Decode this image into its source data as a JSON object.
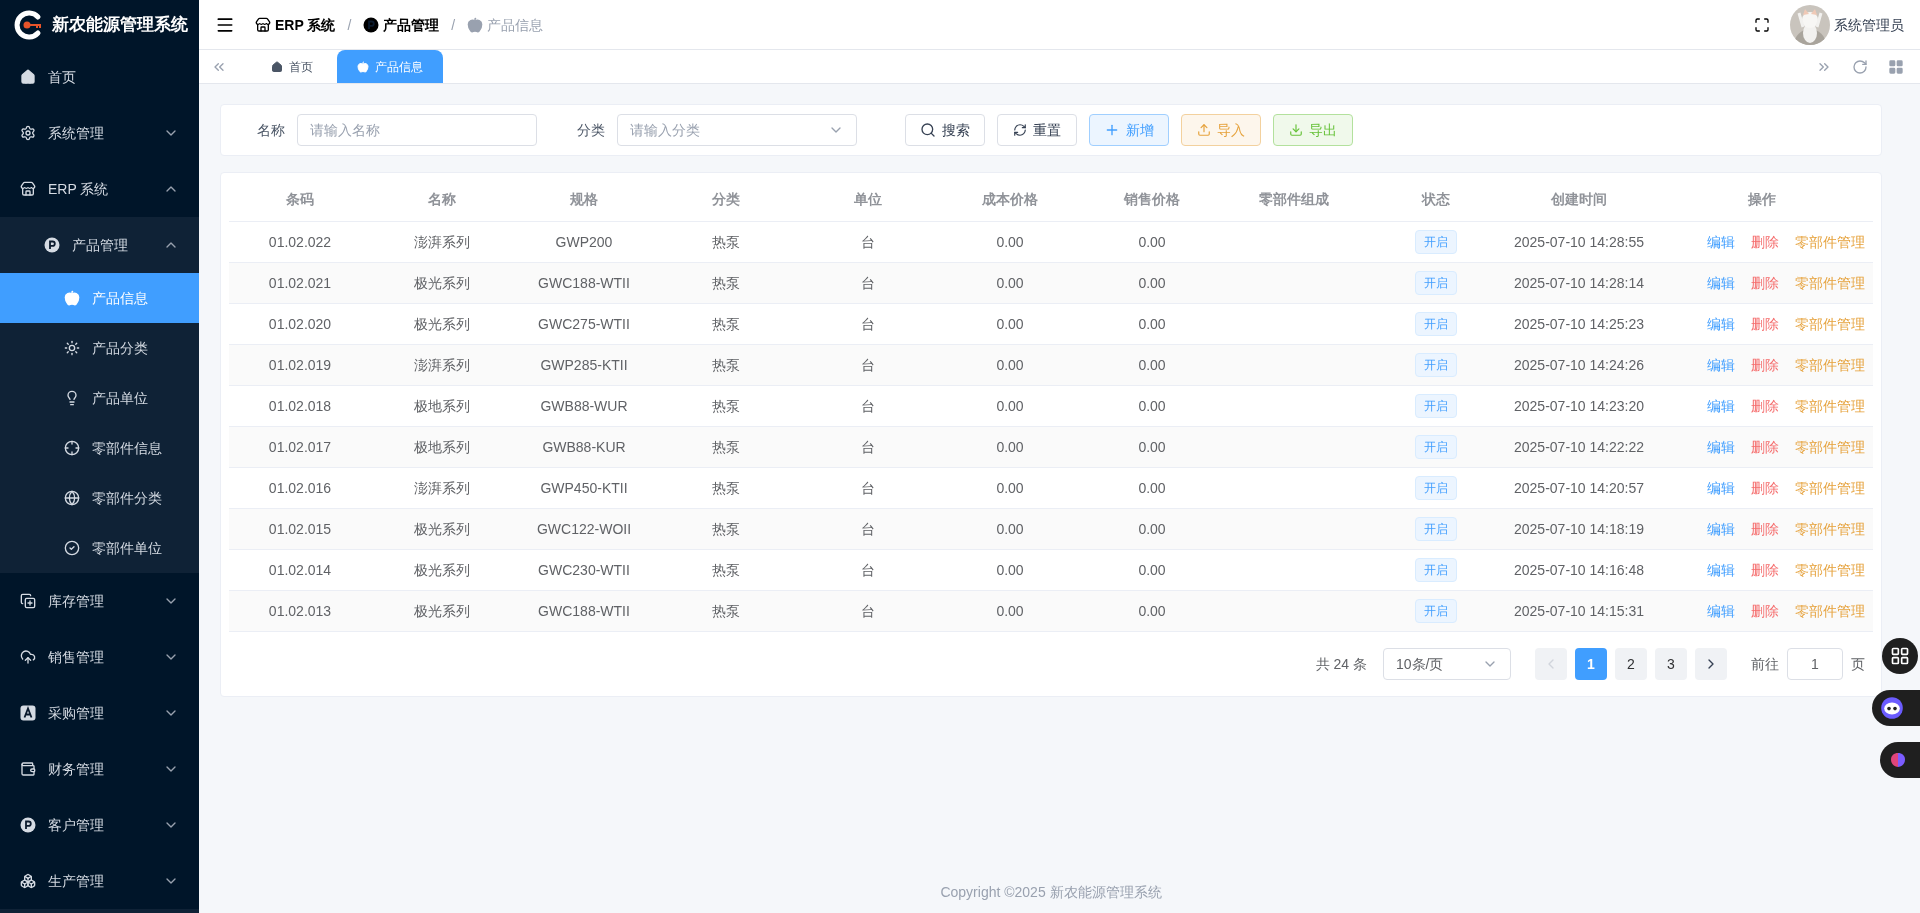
{
  "sidebar": {
    "title": "新农能源管理系统",
    "items": [
      {
        "label": "首页",
        "selected": false
      },
      {
        "label": "系统管理",
        "selected": false,
        "expanded": false
      },
      {
        "label": "ERP 系统",
        "selected": false,
        "expanded": true,
        "children": [
          {
            "label": "产品管理",
            "selected": false,
            "expanded": true,
            "children": [
              {
                "label": "产品信息",
                "selected": true
              },
              {
                "label": "产品分类",
                "selected": false
              },
              {
                "label": "产品单位",
                "selected": false
              },
              {
                "label": "零部件信息",
                "selected": false
              },
              {
                "label": "零部件分类",
                "selected": false
              },
              {
                "label": "零部件单位",
                "selected": false
              }
            ]
          }
        ]
      },
      {
        "label": "库存管理",
        "selected": false,
        "expanded": false
      },
      {
        "label": "销售管理",
        "selected": false,
        "expanded": false
      },
      {
        "label": "采购管理",
        "selected": false,
        "expanded": false
      },
      {
        "label": "财务管理",
        "selected": false,
        "expanded": false
      },
      {
        "label": "客户管理",
        "selected": false,
        "expanded": false
      },
      {
        "label": "生产管理",
        "selected": false,
        "expanded": false
      }
    ]
  },
  "header": {
    "breadcrumbs": [
      {
        "label": "ERP 系统",
        "current": false
      },
      {
        "separator": "/",
        "label": "产品管理",
        "current": false
      },
      {
        "separator": "/",
        "label": "产品信息",
        "current": true
      }
    ],
    "user": "系统管理员"
  },
  "tabs": [
    {
      "label": "首页",
      "selected": false
    },
    {
      "label": "产品信息",
      "selected": true
    }
  ],
  "filters": [
    {
      "label": "名称",
      "placeholder": "请输入名称",
      "kind": "text"
    },
    {
      "label": "分类",
      "placeholder": "请输入分类",
      "kind": "select"
    }
  ],
  "buttons": [
    {
      "label": "搜索",
      "kind": "search"
    },
    {
      "label": "重置",
      "kind": "reset"
    },
    {
      "label": "新增",
      "kind": "add"
    },
    {
      "label": "导入",
      "kind": "import"
    },
    {
      "label": "导出",
      "kind": "export"
    }
  ],
  "table": {
    "columns": [
      "条码",
      "名称",
      "规格",
      "分类",
      "单位",
      "成本价格",
      "销售价格",
      "零部件组成",
      "状态",
      "创建时间",
      "操作"
    ],
    "rows": [
      {
        "barcode": "01.02.022",
        "name": "澎湃系列",
        "spec": "GWP200",
        "category": "热泵",
        "unit": "台",
        "cost": "0.00",
        "price": "0.00",
        "status": "开启",
        "created": "2025-07-10 14:28:55",
        "actions": [
          "编辑",
          "删除",
          "零部件管理"
        ]
      },
      {
        "barcode": "01.02.021",
        "name": "极光系列",
        "spec": "GWC188-WTII",
        "category": "热泵",
        "unit": "台",
        "cost": "0.00",
        "price": "0.00",
        "status": "开启",
        "created": "2025-07-10 14:28:14",
        "actions": [
          "编辑",
          "删除",
          "零部件管理"
        ]
      },
      {
        "barcode": "01.02.020",
        "name": "极光系列",
        "spec": "GWC275-WTII",
        "category": "热泵",
        "unit": "台",
        "cost": "0.00",
        "price": "0.00",
        "status": "开启",
        "created": "2025-07-10 14:25:23",
        "actions": [
          "编辑",
          "删除",
          "零部件管理"
        ]
      },
      {
        "barcode": "01.02.019",
        "name": "澎湃系列",
        "spec": "GWP285-KTII",
        "category": "热泵",
        "unit": "台",
        "cost": "0.00",
        "price": "0.00",
        "status": "开启",
        "created": "2025-07-10 14:24:26",
        "actions": [
          "编辑",
          "删除",
          "零部件管理"
        ]
      },
      {
        "barcode": "01.02.018",
        "name": "极地系列",
        "spec": "GWB88-WUR",
        "category": "热泵",
        "unit": "台",
        "cost": "0.00",
        "price": "0.00",
        "status": "开启",
        "created": "2025-07-10 14:23:20",
        "actions": [
          "编辑",
          "删除",
          "零部件管理"
        ]
      },
      {
        "barcode": "01.02.017",
        "name": "极地系列",
        "spec": "GWB88-KUR",
        "category": "热泵",
        "unit": "台",
        "cost": "0.00",
        "price": "0.00",
        "status": "开启",
        "created": "2025-07-10 14:22:22",
        "actions": [
          "编辑",
          "删除",
          "零部件管理"
        ]
      },
      {
        "barcode": "01.02.016",
        "name": "澎湃系列",
        "spec": "GWP450-KTII",
        "category": "热泵",
        "unit": "台",
        "cost": "0.00",
        "price": "0.00",
        "status": "开启",
        "created": "2025-07-10 14:20:57",
        "actions": [
          "编辑",
          "删除",
          "零部件管理"
        ]
      },
      {
        "barcode": "01.02.015",
        "name": "极光系列",
        "spec": "GWC122-WOII",
        "category": "热泵",
        "unit": "台",
        "cost": "0.00",
        "price": "0.00",
        "status": "开启",
        "created": "2025-07-10 14:18:19",
        "actions": [
          "编辑",
          "删除",
          "零部件管理"
        ]
      },
      {
        "barcode": "01.02.014",
        "name": "极光系列",
        "spec": "GWC230-WTII",
        "category": "热泵",
        "unit": "台",
        "cost": "0.00",
        "price": "0.00",
        "status": "开启",
        "created": "2025-07-10 14:16:48",
        "actions": [
          "编辑",
          "删除",
          "零部件管理"
        ]
      },
      {
        "barcode": "01.02.013",
        "name": "极光系列",
        "spec": "GWC188-WTII",
        "category": "热泵",
        "unit": "台",
        "cost": "0.00",
        "price": "0.00",
        "status": "开启",
        "created": "2025-07-10 14:15:31",
        "actions": [
          "编辑",
          "删除",
          "零部件管理"
        ]
      }
    ]
  },
  "pagination": {
    "total": "共 24 条",
    "page_size": "10条/页",
    "prev_disabled": true,
    "pages": [
      {
        "label": "1",
        "selected": true
      },
      {
        "label": "2",
        "selected": false
      },
      {
        "label": "3",
        "selected": false
      }
    ],
    "goto_label": "前往",
    "goto_value": "1",
    "goto_suffix": "页"
  },
  "footer": "Copyright ©2025 新农能源管理系统"
}
